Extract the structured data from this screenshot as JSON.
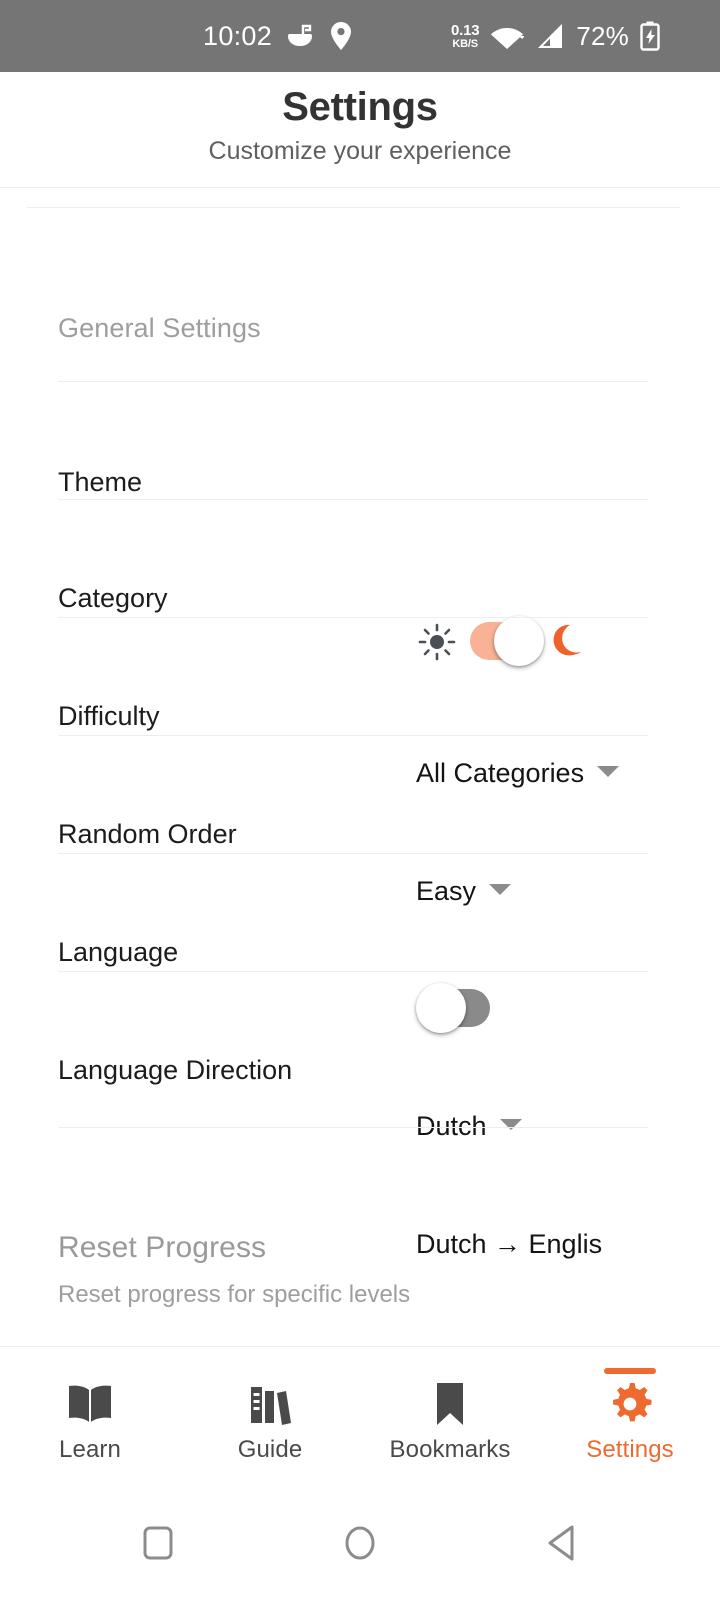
{
  "statusbar": {
    "time": "10:02",
    "network_speed_value": "0.13",
    "network_speed_unit": "KB/S",
    "battery_percent": "72%",
    "icons": [
      "bowl-icon",
      "location-pin-icon",
      "wifi-icon",
      "cellular-signal-icon",
      "battery-charging-icon"
    ]
  },
  "header": {
    "title": "Settings",
    "subtitle": "Customize your experience"
  },
  "sections": {
    "general": {
      "title": "General Settings"
    },
    "reset": {
      "title": "Reset Progress",
      "subtitle": "Reset progress for specific levels"
    }
  },
  "rows": {
    "theme": {
      "label": "Theme",
      "light_icon": "sun-icon",
      "dark_icon": "moon-icon",
      "toggle_state": "on"
    },
    "category": {
      "label": "Category",
      "value": "All Categories"
    },
    "difficulty": {
      "label": "Difficulty",
      "value": "Easy"
    },
    "random": {
      "label": "Random Order",
      "toggle_state": "off"
    },
    "language": {
      "label": "Language",
      "value": "Dutch"
    },
    "direction": {
      "label": "Language Direction",
      "value": "Dutch → Englis"
    }
  },
  "bottom_nav": {
    "items": [
      {
        "label": "Learn",
        "icon": "open-book-icon",
        "active": false
      },
      {
        "label": "Guide",
        "icon": "bookshelf-icon",
        "active": false
      },
      {
        "label": "Bookmarks",
        "icon": "bookmark-icon",
        "active": false
      },
      {
        "label": "Settings",
        "icon": "gear-icon",
        "active": true
      }
    ]
  },
  "android_nav": {
    "recents": "square-recents-icon",
    "home": "circle-home-icon",
    "back": "triangle-back-icon"
  },
  "colors": {
    "accent": "#ef6a2e",
    "toggle_on_track": "#f9b295",
    "toggle_off_track": "#8a8a8a",
    "statusbar_bg": "#757575",
    "muted_text": "#9e9e9e"
  }
}
